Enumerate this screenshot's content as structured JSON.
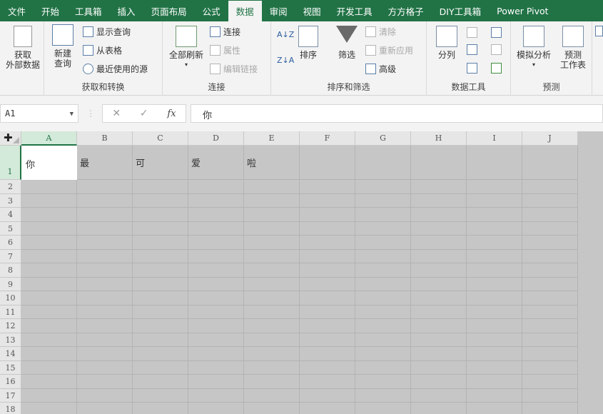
{
  "tabs": [
    "文件",
    "开始",
    "工具箱",
    "插入",
    "页面布局",
    "公式",
    "数据",
    "审阅",
    "视图",
    "开发工具",
    "方方格子",
    "DIY工具箱",
    "Power Pivot"
  ],
  "active_tab": "数据",
  "ribbon": {
    "get_external": "获取\n外部数据",
    "new_query": "新建\n查询",
    "show_queries": "显示查询",
    "from_table": "从表格",
    "recent_sources": "最近使用的源",
    "group_get_transform": "获取和转换",
    "refresh_all": "全部刷新",
    "connections": "连接",
    "properties": "属性",
    "edit_links": "编辑链接",
    "group_connections": "连接",
    "sort": "排序",
    "filter": "筛选",
    "clear": "清除",
    "reapply": "重新应用",
    "advanced": "高级",
    "group_sort_filter": "排序和筛选",
    "text_to_columns": "分列",
    "group_data_tools": "数据工具",
    "what_if": "模拟分析",
    "forecast_sheet": "预测\n工作表",
    "group_forecast": "预测"
  },
  "formula_bar": {
    "name_box": "A1",
    "cancel": "✕",
    "enter": "✓",
    "fx": "fx",
    "value": "你"
  },
  "columns": [
    "A",
    "B",
    "C",
    "D",
    "E",
    "F",
    "G",
    "H",
    "I",
    "J"
  ],
  "rows": [
    "1",
    "2",
    "3",
    "4",
    "5",
    "6",
    "7",
    "8",
    "9",
    "10",
    "11",
    "12",
    "13",
    "14",
    "15",
    "16",
    "17",
    "18"
  ],
  "cells": {
    "A1": "你",
    "B1": "最",
    "C1": "可",
    "D1": "爱",
    "E1": "啦"
  },
  "colors": {
    "excel_green": "#217346",
    "sheet_grey": "#c6c6c6"
  }
}
